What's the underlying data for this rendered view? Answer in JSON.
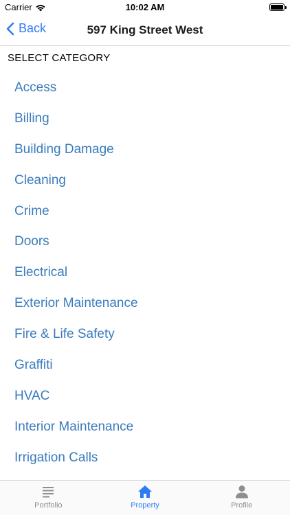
{
  "status_bar": {
    "carrier": "Carrier",
    "time": "10:02 AM"
  },
  "nav": {
    "back_label": "Back",
    "title": "597 King Street West"
  },
  "section_header": "SELECT CATEGORY",
  "categories": [
    "Access",
    "Billing",
    "Building Damage",
    "Cleaning",
    "Crime",
    "Doors",
    "Electrical",
    "Exterior Maintenance",
    "Fire & Life Safety",
    "Graffiti",
    "HVAC",
    "Interior Maintenance",
    "Irrigation Calls"
  ],
  "tabs": [
    {
      "label": "Portfolio",
      "icon": "list-icon",
      "active": false
    },
    {
      "label": "Property",
      "icon": "home-icon",
      "active": true
    },
    {
      "label": "Profile",
      "icon": "person-icon",
      "active": false
    }
  ],
  "colors": {
    "accent": "#2f7bf6",
    "category_text": "#3a7bbd",
    "inactive_tab": "#8e8e93"
  }
}
